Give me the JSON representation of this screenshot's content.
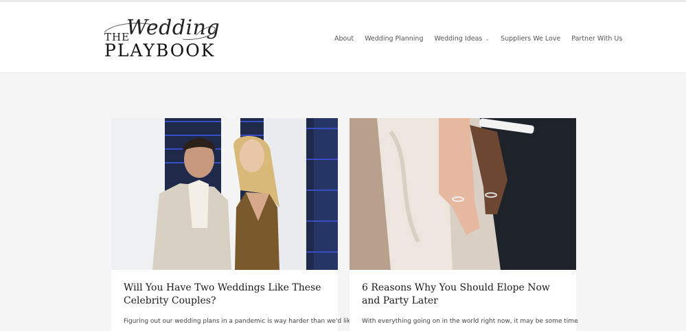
{
  "brand": {
    "logo_the": "THE",
    "logo_wedding": "Wedding",
    "logo_playbook": "PLAYBOOK"
  },
  "nav": {
    "items": [
      {
        "label": "About"
      },
      {
        "label": "Wedding Planning"
      },
      {
        "label": "Wedding Ideas",
        "has_dropdown": true
      },
      {
        "label": "Suppliers We Love"
      },
      {
        "label": "Partner With Us"
      }
    ]
  },
  "posts": [
    {
      "title": "Will You Have Two Weddings Like These Celebrity Couples?",
      "excerpt": "Figuring out our wedding plans in a pandemic is way harder than we'd like",
      "image": "celebrity-couple-photo"
    },
    {
      "title": "6 Reasons Why You Should Elope Now and Party Later",
      "excerpt": "With everything going on in the world right now, it may be some time",
      "image": "holding-hands-rings-photo"
    }
  ]
}
